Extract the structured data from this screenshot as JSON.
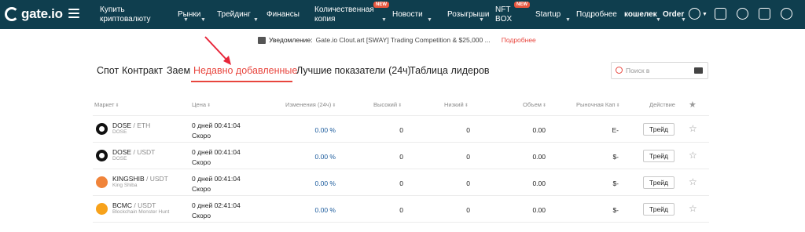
{
  "navbar": {
    "logo": "gate.io",
    "items": [
      {
        "label": "Купить криптовалюту",
        "dropdown": true
      },
      {
        "label": "Рынки",
        "dropdown": true
      },
      {
        "label": "Трейдинг",
        "dropdown": true
      },
      {
        "label": "Финансы",
        "dropdown": false
      },
      {
        "label": "Количественная копия",
        "dropdown": true,
        "badge": "NEW"
      },
      {
        "label": "Новости",
        "dropdown": true
      },
      {
        "label": "Розыгрыши",
        "dropdown": true
      },
      {
        "label": "NFT BOX",
        "dropdown": false,
        "badge": "NEW"
      },
      {
        "label": "Startup",
        "dropdown": true
      },
      {
        "label": "Подробнее",
        "dropdown": false
      },
      {
        "label": "кошелек",
        "dropdown": true
      },
      {
        "label": "Order",
        "dropdown": true
      }
    ],
    "icons": [
      "user-icon",
      "bank-icon",
      "headset-icon",
      "download-icon",
      "globe-icon"
    ]
  },
  "notice": {
    "label": "Уведомление:",
    "text": "Gate.io Clout.art [SWAY] Trading Competition & $25,000 ...",
    "more": "Подробнее"
  },
  "tabs": [
    "Спот",
    "Контракт",
    "Заем",
    "Недавно добавленные",
    "Лучшие показатели (24ч)",
    "Таблица лидеров"
  ],
  "active_tab": "Недавно добавленные",
  "search": {
    "placeholder": "Поиск в"
  },
  "table": {
    "headers": {
      "market": "Маркет",
      "price": "Цена",
      "change": "Изменения (24ч)",
      "high": "Высокий",
      "low": "Низкий",
      "volume": "Объем",
      "cap": "Рыночная Кап",
      "action": "Действие"
    },
    "rows": [
      {
        "base": "DOSE",
        "quote": "ETH",
        "name": "DOSE",
        "time": "0 дней 00:41:04",
        "status": "Скоро",
        "change": "0.00 %",
        "high": "0",
        "low": "0",
        "volume": "0.00",
        "cap": "E-",
        "action": "Трейд",
        "logo": "dose"
      },
      {
        "base": "DOSE",
        "quote": "USDT",
        "name": "DOSE",
        "time": "0 дней 00:41:04",
        "status": "Скоро",
        "change": "0.00 %",
        "high": "0",
        "low": "0",
        "volume": "0.00",
        "cap": "$-",
        "action": "Трейд",
        "logo": "dose"
      },
      {
        "base": "KINGSHIB",
        "quote": "USDT",
        "name": "King Shiba",
        "time": "0 дней 00:41:04",
        "status": "Скоро",
        "change": "0.00 %",
        "high": "0",
        "low": "0",
        "volume": "0.00",
        "cap": "$-",
        "action": "Трейд",
        "logo": "shib"
      },
      {
        "base": "BCMC",
        "quote": "USDT",
        "name": "Blockchain Monster Hunt",
        "time": "0 дней 02:41:04",
        "status": "Скоро",
        "change": "0.00 %",
        "high": "0",
        "low": "0",
        "volume": "0.00",
        "cap": "$-",
        "action": "Трейд",
        "logo": "bcmc"
      }
    ]
  },
  "colors": {
    "navbar": "#0f3e4e",
    "accent": "#e8463e",
    "change": "#1a5a9c"
  }
}
